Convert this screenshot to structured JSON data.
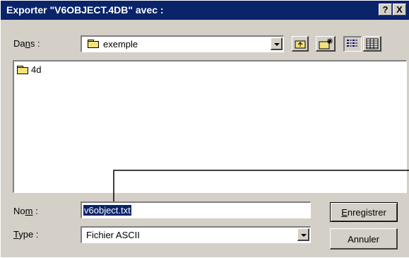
{
  "window": {
    "title": "Exporter \"V6OBJECT.4DB\" avec :",
    "help_label": "?",
    "close_label": "X"
  },
  "lookin": {
    "label_pre": "Da",
    "label_ul": "n",
    "label_post": "s :",
    "value": "exemple"
  },
  "toolbar": {
    "buttons": [
      "up-one-level-icon",
      "new-folder-icon",
      "list-view-icon",
      "details-view-icon"
    ]
  },
  "filelist": {
    "items": [
      {
        "name": "4d",
        "icon": "folder-icon"
      }
    ]
  },
  "filename": {
    "label_pre": "No",
    "label_ul": "m",
    "label_post": " :",
    "value": "v6object.txt"
  },
  "filetype": {
    "label_ul": "T",
    "label_post": "ype :",
    "value": "Fichier ASCII"
  },
  "buttons": {
    "save_ul": "E",
    "save_post": "nregistrer",
    "cancel": "Annuler"
  }
}
